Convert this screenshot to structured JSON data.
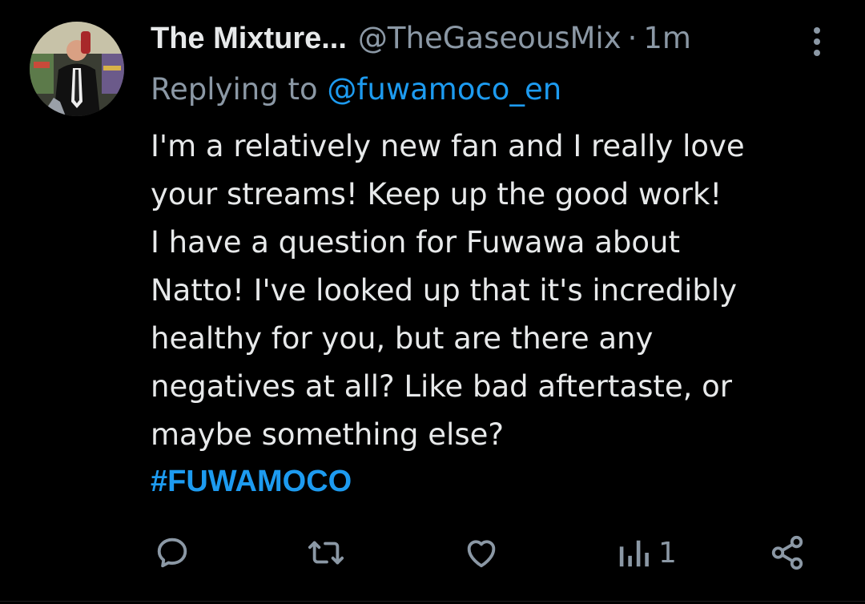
{
  "tweet": {
    "display_name": "The Mixture...",
    "handle": "@TheGaseousMix",
    "separator": "·",
    "time": "1m",
    "replying_prefix": "Replying to",
    "replying_to": "@fuwamoco_en",
    "body_lines": [
      "I'm a relatively new fan and I really love",
      "your streams! Keep up the good work!",
      "I have a question for Fuwawa about",
      "Natto! I've looked up that it's incredibly",
      "healthy for you, but are there any",
      "negatives at all? Like bad aftertaste, or",
      "maybe something else?"
    ],
    "hashtag": "#FUWAMOCO"
  },
  "actions": {
    "reply_icon": "reply-icon",
    "retweet_icon": "retweet-icon",
    "like_icon": "heart-icon",
    "views_icon": "views-icon",
    "views_count": "1",
    "share_icon": "share-icon"
  },
  "colors": {
    "background": "#000000",
    "text": "#e7e9ea",
    "muted": "#8b98a5",
    "accent": "#1d9bf0"
  }
}
